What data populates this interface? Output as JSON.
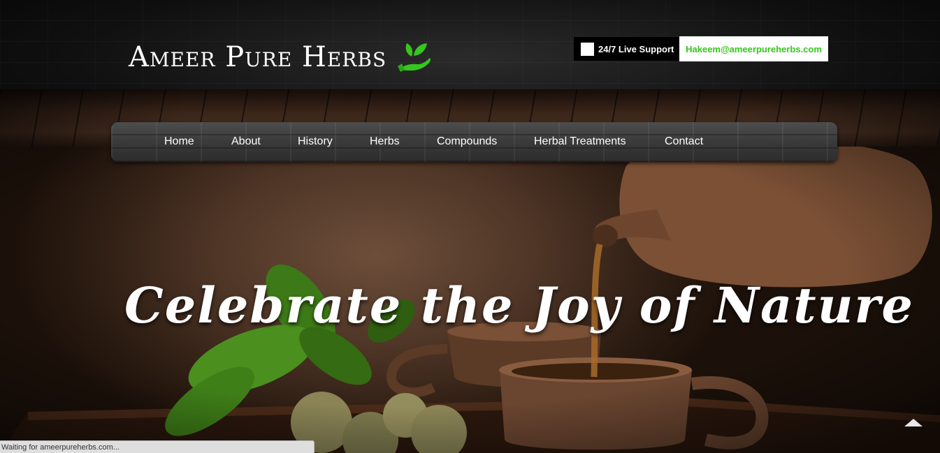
{
  "brand": {
    "name": "Ameer Pure Herbs",
    "accent_color": "#35c71d"
  },
  "header": {
    "support_label": "24/7 Live Support",
    "email": "Hakeem@ameerpureherbs.com"
  },
  "nav": {
    "items": [
      {
        "label": "Home"
      },
      {
        "label": "About"
      },
      {
        "label": "History"
      },
      {
        "label": "Herbs"
      },
      {
        "label": "Compounds"
      },
      {
        "label": "Herbal Treatments"
      },
      {
        "label": "Contact"
      }
    ]
  },
  "hero": {
    "title": "Celebrate the Joy of Nature"
  },
  "icons": {
    "logo": "leaf-hand-icon",
    "scroll_top": "triangle-up-icon"
  },
  "status_bar": {
    "text": "Waiting for ameerpureherbs.com..."
  }
}
